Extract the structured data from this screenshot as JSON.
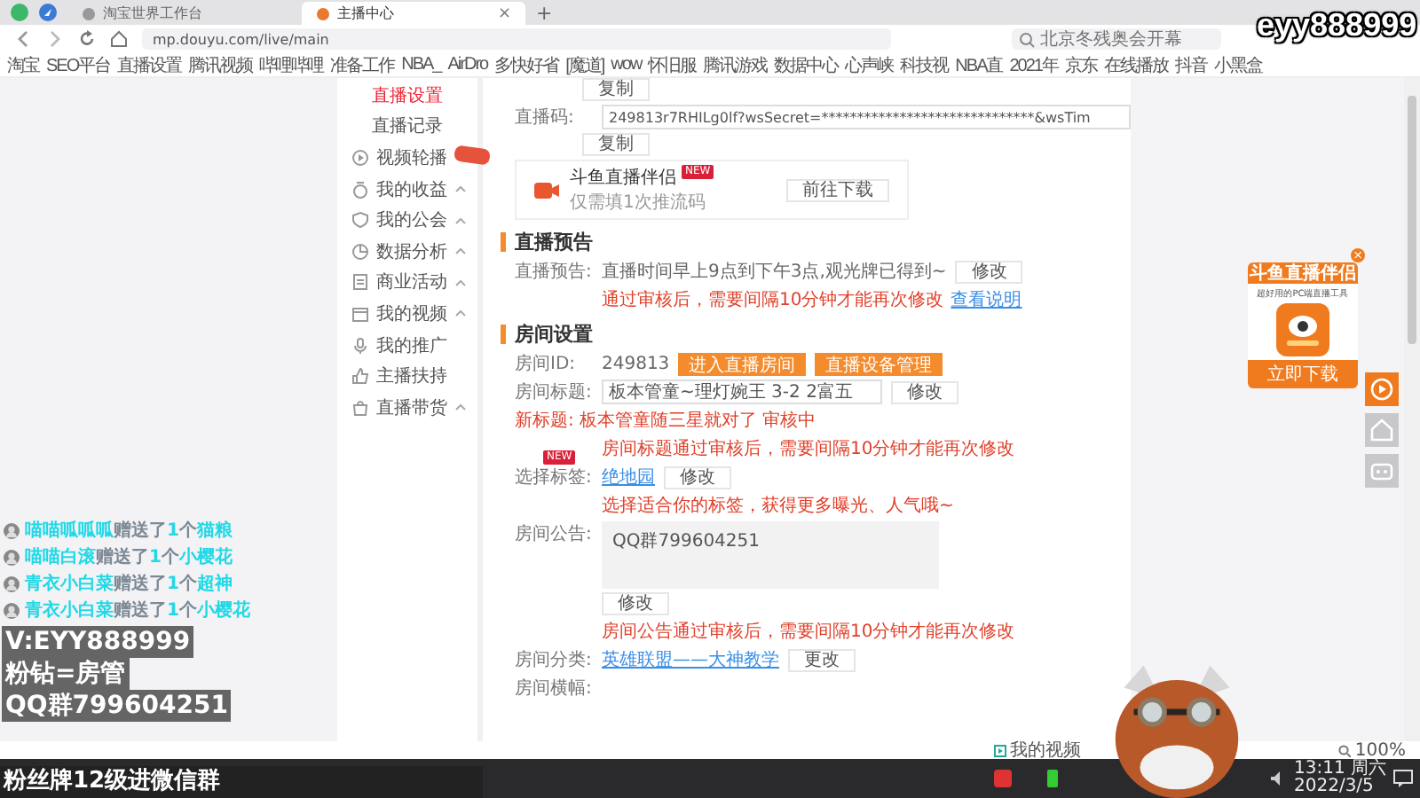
{
  "tabs": [
    {
      "label": "淘宝世界工作台",
      "selected": false
    },
    {
      "label": "主播中心",
      "selected": true,
      "close": "×"
    }
  ],
  "new_tab": "+",
  "address": {
    "url": "mp.douyu.com/live/main",
    "search_placeholder": "北京冬残奥会开幕"
  },
  "bookmarks": [
    "淘宝",
    "SEO平台",
    "直播设置",
    "腾讯视频",
    "哔哩哔哩",
    "准备工作",
    "NBA_",
    "AirDro",
    "多快好省",
    "[魔道]",
    "wow",
    "怀旧服",
    "腾讯游戏",
    "数据中心",
    "心声峡",
    "科技视",
    "NBA直",
    "2021年",
    "京东",
    "在线播放",
    "抖音",
    "小黑盒"
  ],
  "chat": {
    "gifts": [
      {
        "user": "喵喵呱呱呱",
        "action": "赠送了",
        "count": "1",
        "unit": "个",
        "gift": "猫粮"
      },
      {
        "user": "喵喵白滚",
        "action": "赠送了",
        "count": "1",
        "unit": "个",
        "gift": "小樱花"
      },
      {
        "user": "青衣小白菜",
        "action": "赠送了",
        "count": "1",
        "unit": "个",
        "gift": "超神"
      },
      {
        "user": "青衣小白菜",
        "action": "赠送了",
        "count": "1",
        "unit": "个",
        "gift": "小樱花"
      }
    ]
  },
  "sidebar": {
    "items": [
      {
        "kind": "sub",
        "label": "直播设置",
        "selected": true,
        "expandable": false
      },
      {
        "kind": "sub",
        "label": "直播记录",
        "selected": false,
        "expandable": false
      },
      {
        "kind": "section",
        "label": "视频轮播",
        "selected": false,
        "expandable": false,
        "tag": true
      },
      {
        "kind": "section",
        "label": "我的收益",
        "selected": false,
        "expandable": true
      },
      {
        "kind": "section",
        "label": "我的公会",
        "selected": false,
        "expandable": true
      },
      {
        "kind": "section",
        "label": "数据分析",
        "selected": false,
        "expandable": true
      },
      {
        "kind": "section",
        "label": "商业活动",
        "selected": false,
        "expandable": true
      },
      {
        "kind": "section",
        "label": "我的视频",
        "selected": false,
        "expandable": true
      },
      {
        "kind": "section",
        "label": "我的推广",
        "selected": false,
        "expandable": false
      },
      {
        "kind": "section",
        "label": "主播扶持",
        "selected": false,
        "expandable": false
      },
      {
        "kind": "section",
        "label": "直播带货",
        "selected": false,
        "expandable": true
      }
    ]
  },
  "main": {
    "copy_button": "复制",
    "stream_code": {
      "label": "直播码:",
      "value": "249813r7RHILg0lf?wsSecret=******************************&wsTim",
      "button": "复制"
    },
    "companion": {
      "title": "斗鱼直播伴侣",
      "badge": "NEW",
      "subtitle": "仅需填1次推流码",
      "button": "前往下载"
    },
    "preview": {
      "heading": "直播预告",
      "label": "直播预告:",
      "value": "直播时间早上9点到下午3点,观光牌已得到~",
      "button": "修改",
      "note": "通过审核后，需要间隔10分钟才能再次修改",
      "link": "查看说明"
    },
    "room": {
      "heading": "房间设置",
      "id_label": "房间ID:",
      "id_value": "249813",
      "id_buttons": [
        "进入直播房间",
        "直播设备管理"
      ],
      "title_label": "房间标题:",
      "title_value": "板本管童~理灯婉王 3-2 2富五",
      "title_button": "修改",
      "pending_label": "新标题:",
      "pending_value": "板本管童随三星就对了",
      "pending_status": "审核中",
      "title_note": "房间标题通过审核后，需要间隔10分钟才能再次修改",
      "tag_label": "选择标签:",
      "tag_badge": "NEW",
      "tag_link": "绝地园",
      "tag_button": "修改",
      "tag_note": "选择适合你的标签，获得更多曝光、人气哦~",
      "notice_label": "房间公告:",
      "notice_value": "QQ群799604251",
      "notice_button": "修改",
      "notice_note": "房间公告通过审核后，需要间隔10分钟才能再次修改",
      "category_label": "房间分类:",
      "category_link": "英雄联盟——大神教学",
      "category_button": "更改",
      "banner_label": "房间横幅:"
    }
  },
  "ad": {
    "close": "×",
    "title": "斗鱼直播伴侣",
    "subtitle": "超好用的PC端直播工具",
    "button": "立即下载"
  },
  "status_bar": {
    "item": "我的视频",
    "zoom": "100%"
  },
  "taskbar": {
    "time": "13:11 周六",
    "date": "2022/3/5"
  },
  "overlay": {
    "handle": "eyy888999",
    "lines": [
      "V:EYY888999",
      "粉钻=房管",
      "QQ群799604251"
    ],
    "banner": "粉丝牌12级进微信群"
  }
}
